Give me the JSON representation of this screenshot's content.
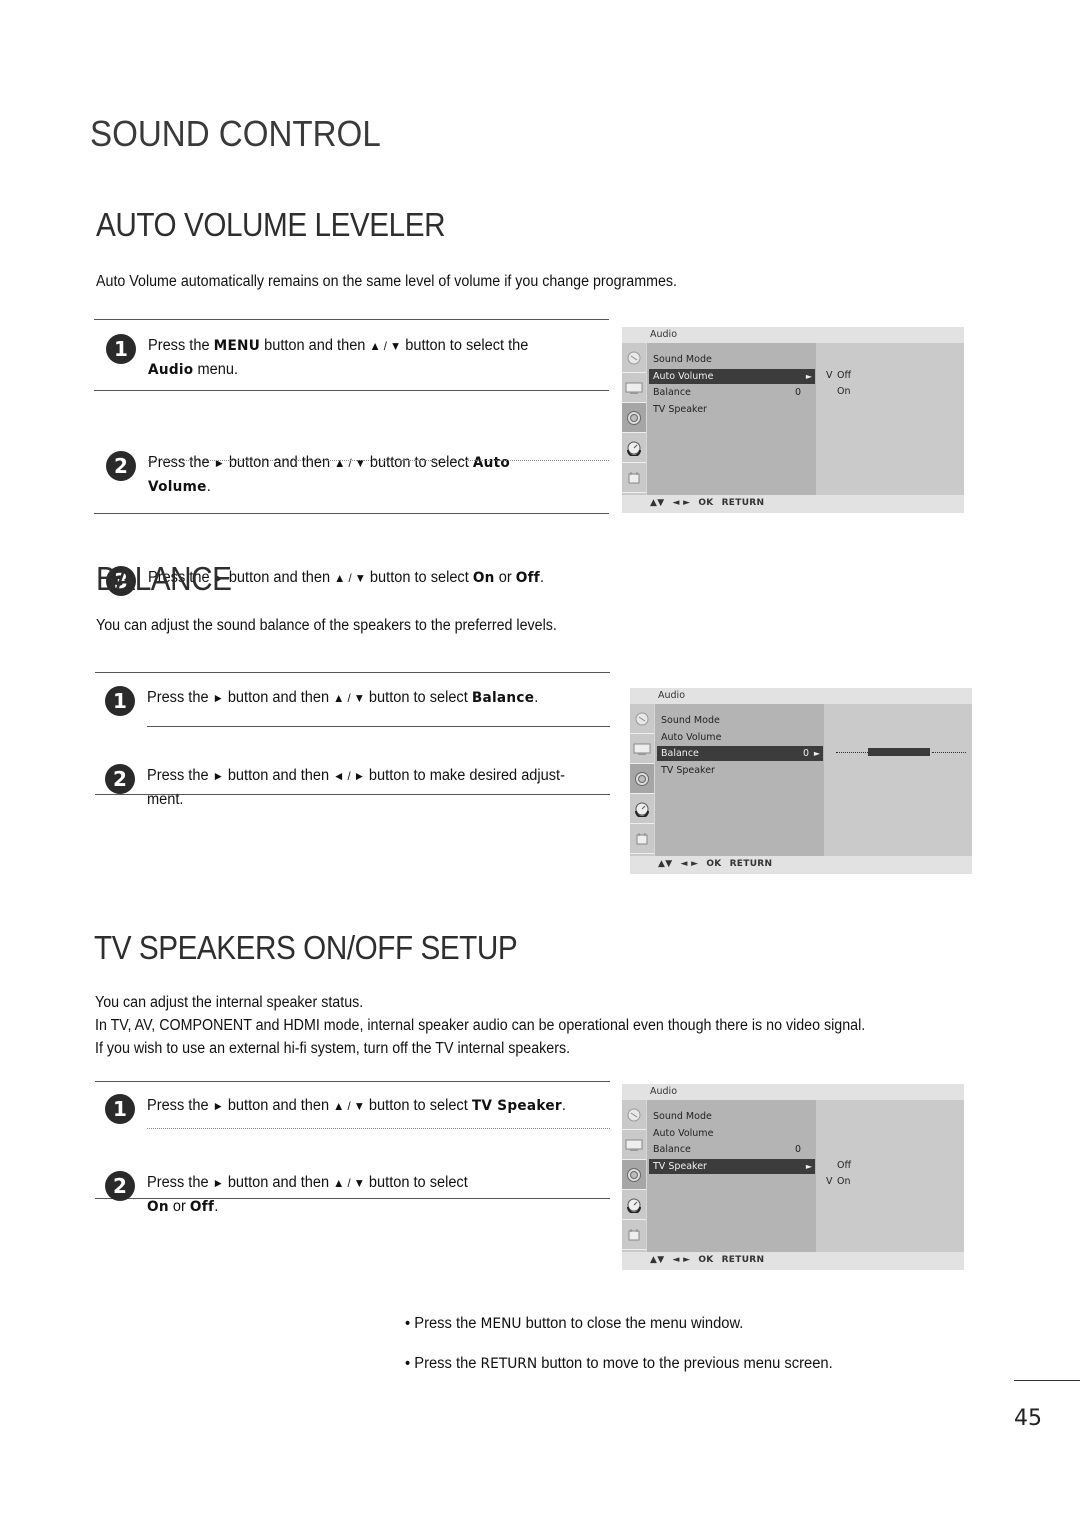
{
  "page_title": "SOUND CONTROL",
  "sections": {
    "auto_volume": {
      "title": "AUTO VOLUME LEVELER",
      "intro": "Auto Volume automatically remains on the same level of volume if you change programmes.",
      "steps": [
        {
          "num": "1",
          "parts": [
            "Press the ",
            {
              "b": "MENU"
            },
            " button and then ",
            {
              "g": "▲ / ▼"
            },
            " button to select the"
          ],
          "line2": [
            {
              "b": "Audio"
            },
            " menu."
          ]
        },
        {
          "num": "2",
          "parts": [
            "Press the ",
            {
              "g": "►"
            },
            " button and then ",
            {
              "g": "▲ / ▼"
            },
            " button to select ",
            {
              "b": "Auto"
            }
          ],
          "line2": [
            {
              "b": "Volume"
            },
            "."
          ]
        },
        {
          "num": "3",
          "parts": [
            "Press the ",
            {
              "g": "►"
            },
            " button and then ",
            {
              "g": "▲ / ▼"
            },
            " button to select ",
            {
              "b": "On"
            },
            " or ",
            {
              "b": "Off"
            },
            "."
          ]
        }
      ],
      "osd": {
        "title": "Audio",
        "items": [
          {
            "label": "Sound Mode",
            "value": "",
            "selected": false
          },
          {
            "label": "Auto Volume",
            "value": "",
            "selected": true,
            "arrow": "►"
          },
          {
            "label": "Balance",
            "value": "0",
            "selected": false
          },
          {
            "label": "TV Speaker",
            "value": "",
            "selected": false
          }
        ],
        "options": [
          {
            "check": "V",
            "label": "Off"
          },
          {
            "check": "",
            "label": "On"
          }
        ],
        "footer": [
          "▲▼",
          "◄ ►",
          "OK",
          "RETURN"
        ]
      }
    },
    "balance": {
      "title": "BALANCE",
      "intro": "You can adjust the sound balance of the speakers to the preferred levels.",
      "steps": [
        {
          "num": "1",
          "parts": [
            "Press the ",
            {
              "g": "►"
            },
            " button and then ",
            {
              "g": "▲ / ▼"
            },
            " button to select ",
            {
              "b": "Balance"
            },
            "."
          ]
        },
        {
          "num": "2",
          "parts": [
            "Press the ",
            {
              "g": "►"
            },
            " button and then ",
            {
              "g": "◄ / ►"
            },
            " button to make desired adjust-"
          ],
          "line2": [
            "ment."
          ]
        }
      ],
      "osd": {
        "title": "Audio",
        "items": [
          {
            "label": "Sound Mode",
            "value": "",
            "selected": false
          },
          {
            "label": "Auto Volume",
            "value": "",
            "selected": false
          },
          {
            "label": "Balance",
            "value": "0",
            "selected": true,
            "arrow": "►"
          },
          {
            "label": "TV Speaker",
            "value": "",
            "selected": false
          }
        ],
        "balance_value": 0,
        "balance_range": [
          -50,
          50
        ],
        "footer": [
          "▲▼",
          "◄ ►",
          "OK",
          "RETURN"
        ]
      }
    },
    "tv_speaker": {
      "title": "TV SPEAKERS ON/OFF SETUP",
      "intro_lines": [
        "You can adjust the internal speaker status.",
        "In TV, AV, COMPONENT and HDMI mode, internal speaker audio can be operational even though there is no video signal.",
        "If you wish to use an external hi-fi system, turn off the TV internal speakers."
      ],
      "steps": [
        {
          "num": "1",
          "parts": [
            "Press the ",
            {
              "g": "►"
            },
            " button and then ",
            {
              "g": "▲ / ▼"
            },
            " button to select ",
            {
              "b": "TV Speaker"
            },
            "."
          ]
        },
        {
          "num": "2",
          "parts": [
            "Press the ",
            {
              "g": "►"
            },
            " button and then ",
            {
              "g": "▲ / ▼"
            },
            " button to select"
          ],
          "line2": [
            {
              "b": "On"
            },
            " or ",
            {
              "b": "Off"
            },
            "."
          ]
        }
      ],
      "osd": {
        "title": "Audio",
        "items": [
          {
            "label": "Sound Mode",
            "value": "",
            "selected": false
          },
          {
            "label": "Auto Volume",
            "value": "",
            "selected": false
          },
          {
            "label": "Balance",
            "value": "0",
            "selected": false
          },
          {
            "label": "TV Speaker",
            "value": "",
            "selected": true,
            "arrow": "►"
          }
        ],
        "options": [
          {
            "check": "",
            "label": "Off"
          },
          {
            "check": "V",
            "label": "On"
          }
        ],
        "footer": [
          "▲▼",
          "◄ ►",
          "OK",
          "RETURN"
        ]
      }
    }
  },
  "osd_icons": [
    "picture-settings-icon",
    "screen-icon",
    "audio-icon",
    "time-icon",
    "option-icon"
  ],
  "notes": [
    {
      "prefix": "• Press the ",
      "b": "MENU",
      "suffix": " button to close the menu window."
    },
    {
      "prefix": "• Press the ",
      "b": "RETURN",
      "suffix": " button to move to the previous menu screen."
    }
  ],
  "page_number": "45"
}
